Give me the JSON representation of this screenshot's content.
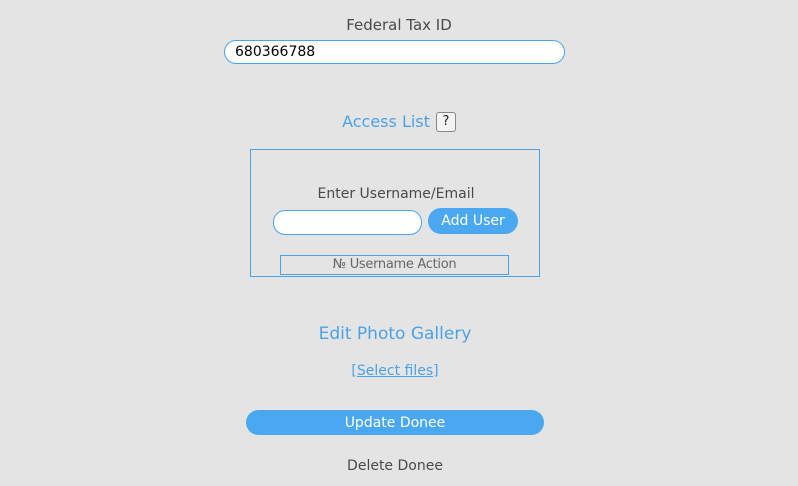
{
  "federal_tax_id": {
    "label": "Federal Tax ID",
    "value": "680366788"
  },
  "access_list": {
    "title": "Access List",
    "help_label": "?",
    "username_label": "Enter Username/Email",
    "username_value": "",
    "add_user_label": "Add User",
    "table_header": "№ Username Action"
  },
  "photo_gallery": {
    "title": "Edit Photo Gallery",
    "select_files_label": "[Select files]"
  },
  "actions": {
    "update_label": "Update Donee",
    "delete_label": "Delete Donee"
  },
  "colors": {
    "accent": "#4aa3e8",
    "background": "#e4e4e4"
  }
}
